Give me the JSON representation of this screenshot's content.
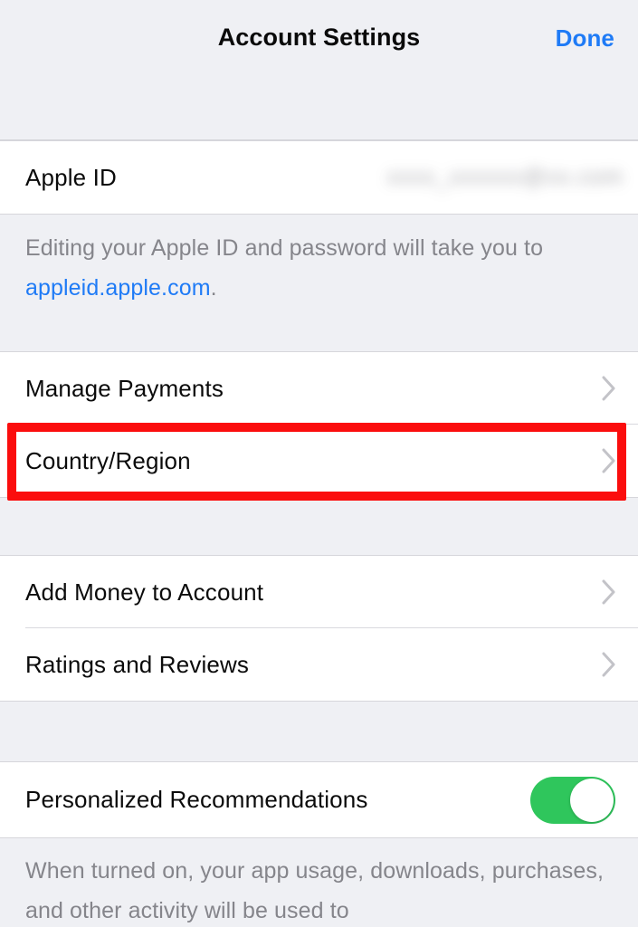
{
  "header": {
    "title": "Account Settings",
    "done_label": "Done"
  },
  "sections": {
    "apple_id": {
      "row_label": "Apple ID",
      "value_redacted": "xxxx_xxxxxx@xx.com",
      "footer_prefix": "Editing your Apple ID and password will take you to ",
      "footer_link": "appleid.apple.com",
      "footer_suffix": "."
    },
    "payments": {
      "manage_payments_label": "Manage Payments",
      "country_region_label": "Country/Region"
    },
    "account": {
      "add_money_label": "Add Money to Account",
      "ratings_reviews_label": "Ratings and Reviews"
    },
    "recommendations": {
      "row_label": "Personalized Recommendations",
      "toggle_state": "on",
      "footer_text": "When turned on, your app usage, downloads, purchases, and other activity will be used to"
    }
  },
  "annotation": {
    "target": "Country/Region",
    "color": "#fb0d0d"
  },
  "colors": {
    "accent_blue": "#1f7bf6",
    "toggle_green": "#2fc65c",
    "background_gray": "#eff0f4",
    "row_white": "#ffffff",
    "secondary_text": "#85858b",
    "annotation_red": "#fb0d0d"
  }
}
